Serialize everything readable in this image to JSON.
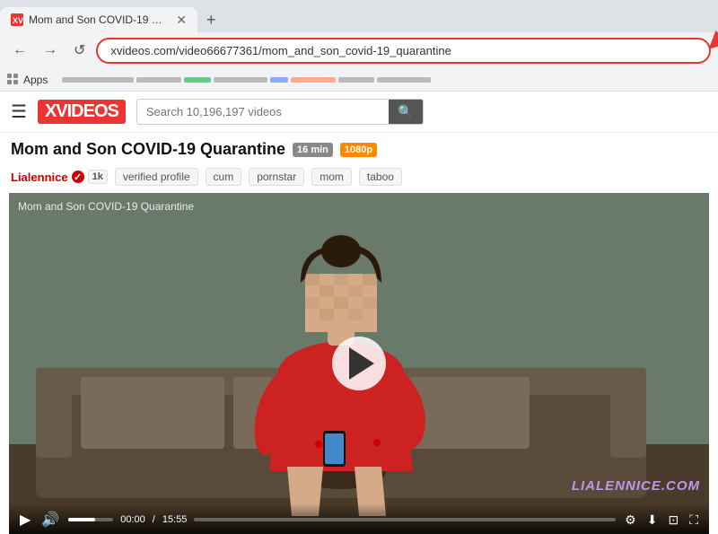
{
  "browser": {
    "tab_title": "Mom and Son COVID-19 Quar...",
    "tab_favicon": "XV",
    "url": "xvideos.com/video66677361/mom_and_son_covid-19_quarantine",
    "nav_back": "←",
    "nav_forward": "→",
    "nav_reload": "↺",
    "new_tab_btn": "+"
  },
  "bookmarks": {
    "apps_label": "Apps"
  },
  "site": {
    "logo": "XVIDEOS",
    "search_placeholder": "Search 10,196,197 videos"
  },
  "video": {
    "title": "Mom and Son COVID-19 Quarantine",
    "duration_badge": "16 min",
    "quality_badge": "1080p",
    "channel_name": "Lialennice",
    "channel_subscribers": "1k",
    "overlay_title": "Mom and Son COVID-19 Quarantine",
    "watermark": "LIALENNICE.COM",
    "time_current": "00:00",
    "time_total": "15:55",
    "tags": [
      "verified profile",
      "cum",
      "pornstar",
      "mom",
      "taboo"
    ]
  },
  "icons": {
    "hamburger": "☰",
    "search": "🔍",
    "play": "▶",
    "volume": "🔊",
    "fullscreen": "⛶",
    "settings": "⚙",
    "download": "⬇",
    "pip": "⊡",
    "lock": "🔒",
    "checkmark": "✓"
  }
}
